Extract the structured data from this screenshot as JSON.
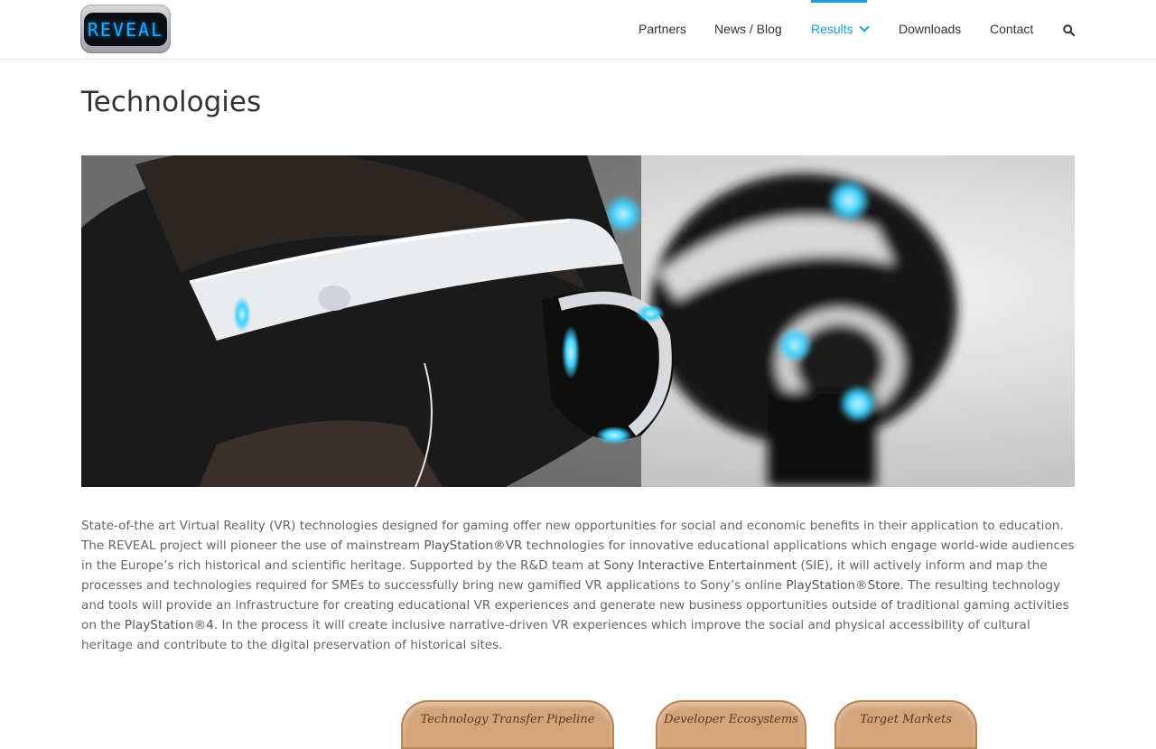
{
  "header": {
    "logo_text": "REVEAL",
    "nav": [
      {
        "label": "Partners"
      },
      {
        "label": "News / Blog"
      },
      {
        "label": "Results",
        "active": true
      },
      {
        "label": "Downloads"
      },
      {
        "label": "Contact"
      }
    ],
    "search_icon": "search-icon",
    "accent_color": "#1a9fd8"
  },
  "page": {
    "title": "Technologies",
    "intro": [
      "State-of-the art Virtual Reality (VR) technologies designed for gaming offer new opportunities for social and economic benefits in their application to education. The REVEAL project will pioneer the use of mainstream ",
      "PlayStation®VR",
      " technologies for innovative educational applications which engage world-wide audiences in the Europe’s rich historical and scientific heritage. Supported by the R&D team at ",
      "Sony Interactive Entertainment",
      " (SIE), it will actively inform and map the processes and technologies required for SMEs to successfully bring new gamified VR applications to Sony’s online ",
      "PlayStation®Store",
      ". The resulting technology and tools will provide an infrastructure for creating educational VR experiences and generate new business opportunities outside of traditional gaming activities on the ",
      "PlayStation®4",
      ". In the process it will create inclusive narrative-driven VR experiences which improve the social and physical accessibility of cultural heritage and contribute to the digital preservation of historical sites."
    ],
    "pills": [
      {
        "label": "Technology Transfer Pipeline"
      },
      {
        "label": "Developer Ecosystems"
      },
      {
        "label": "Target Markets"
      }
    ]
  },
  "colors": {
    "pill_fill": "#d4a57a",
    "pill_border": "#b98555",
    "vr_glow": "#3fd1ff"
  }
}
